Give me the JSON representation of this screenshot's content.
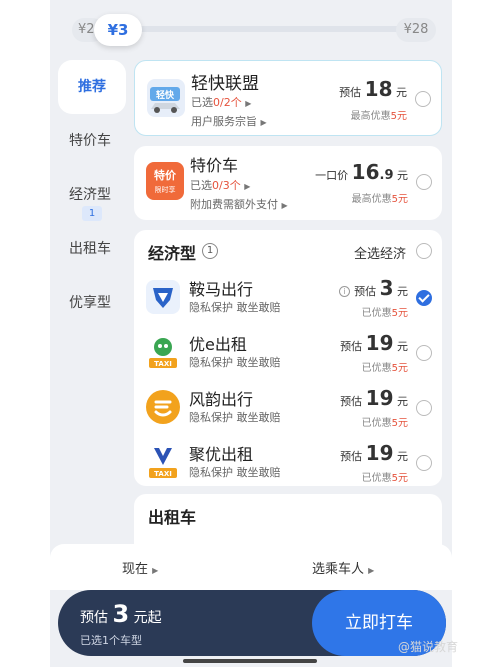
{
  "slider": {
    "min": "¥2",
    "max": "¥28",
    "current": "¥3"
  },
  "nav": {
    "items": [
      {
        "label": "推荐"
      },
      {
        "label": "特价车"
      },
      {
        "label": "经济型",
        "badge": "1"
      },
      {
        "label": "出租车"
      },
      {
        "label": "优享型"
      }
    ]
  },
  "recommend": [
    {
      "logo_text": "轻快",
      "title": "轻快联盟",
      "sub_prefix": "已选",
      "sub_count": "0/2个",
      "note": "用户服务宗旨",
      "price_prefix": "预估",
      "price": "18",
      "price_unit": "元",
      "disc_prefix": "最高优惠",
      "disc": "5元",
      "logo_color": "#e7eef9"
    },
    {
      "logo_text": "特价",
      "logo_text2": "限时享",
      "title": "特价车",
      "sub_prefix": "已选",
      "sub_count": "0/3个",
      "note": "附加费需额外支付",
      "price_prefix": "一口价",
      "price": "16",
      "price_decimal": ".9",
      "price_unit": "元",
      "disc_prefix": "最高优惠",
      "disc": "5元",
      "logo_color": "#f06a3a"
    }
  ],
  "economy": {
    "title": "经济型",
    "count": "1",
    "select_all": "全选经济",
    "items": [
      {
        "name": "鞍马出行",
        "tags": "隐私保护  敢坐敢赔",
        "price_prefix": "预估",
        "price": "3",
        "unit": "元",
        "disc_prefix": "已优惠",
        "disc": "5元",
        "checked": true,
        "logo_color": "#2a63c8"
      },
      {
        "name": "优e出租",
        "tags": "隐私保护  敢坐敢赔",
        "price_prefix": "预估",
        "price": "19",
        "unit": "元",
        "disc_prefix": "已优惠",
        "disc": "5元",
        "checked": false,
        "logo_color": "#3aa652",
        "taxi": "TAXI"
      },
      {
        "name": "风韵出行",
        "tags": "隐私保护  敢坐敢赔",
        "price_prefix": "预估",
        "price": "19",
        "unit": "元",
        "disc_prefix": "已优惠",
        "disc": "5元",
        "checked": false,
        "logo_color": "#f2a21d"
      },
      {
        "name": "聚优出租",
        "tags": "隐私保护  敢坐敢赔",
        "price_prefix": "预估",
        "price": "19",
        "unit": "元",
        "disc_prefix": "已优惠",
        "disc": "5元",
        "checked": false,
        "logo_color": "#2b52b5",
        "taxi": "TAXI"
      }
    ]
  },
  "taxi_section": {
    "title": "出租车"
  },
  "options": {
    "now": "现在",
    "passenger": "选乘车人"
  },
  "bottom": {
    "est_prefix": "预估",
    "est_price": "3",
    "est_suffix": "元起",
    "selected": "已选1个车型",
    "call": "立即打车"
  },
  "watermark": "@猫说教育"
}
